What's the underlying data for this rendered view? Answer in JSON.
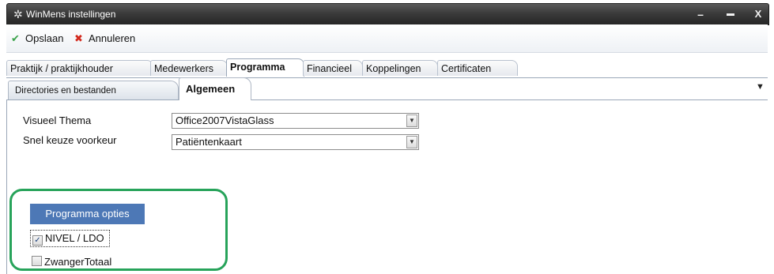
{
  "window": {
    "title": "WinMens instellingen",
    "icon": "gear-icon"
  },
  "toolbar": {
    "save_label": "Opslaan",
    "save_icon": "checkmark-icon",
    "cancel_label": "Annuleren",
    "cancel_icon": "red-x-icon"
  },
  "tabs": [
    {
      "label": "Praktijk / praktijkhouder"
    },
    {
      "label": "Medewerkers"
    },
    {
      "label": "Programma"
    },
    {
      "label": "Financieel"
    },
    {
      "label": "Koppelingen"
    },
    {
      "label": "Certificaten"
    }
  ],
  "active_tab": "Programma",
  "subtabs": [
    {
      "label": "Directories en bestanden"
    },
    {
      "label": "Algemeen"
    }
  ],
  "active_subtab": "Algemeen",
  "fields": {
    "theme": {
      "label": "Visueel Thema",
      "value": "Office2007VistaGlass"
    },
    "quick": {
      "label": "Snel keuze voorkeur",
      "value": "Patiëntenkaart"
    }
  },
  "options": {
    "header": "Programma opties",
    "items": [
      {
        "label": "NIVEL / LDO",
        "checked": true
      },
      {
        "label": "ZwangerTotaal",
        "checked": false
      }
    ]
  },
  "colors": {
    "highlight_border": "#27a35a",
    "group_header_bg": "#4d78b6",
    "titlebar_bg": "#2f2f2f"
  }
}
